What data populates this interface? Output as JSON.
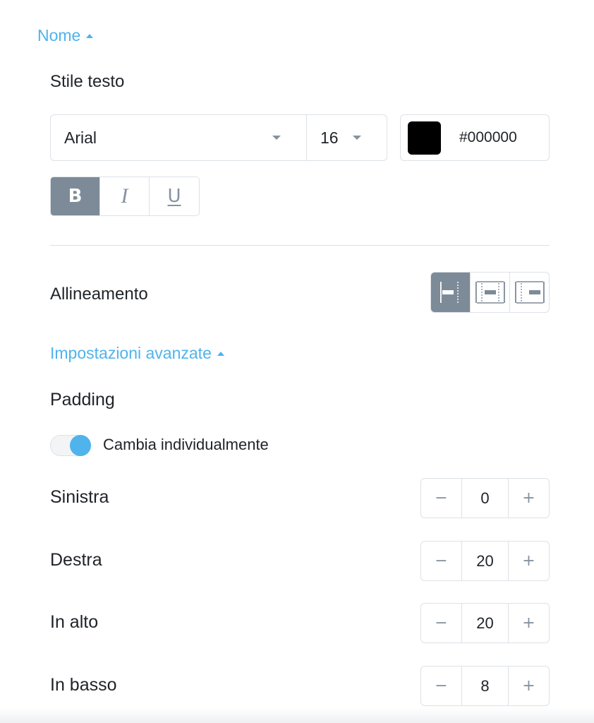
{
  "sections": {
    "name_link": "Nome",
    "advanced_link": "Impostazioni avanzate"
  },
  "text_style": {
    "heading": "Stile testo",
    "font_family": "Arial",
    "font_size": "16",
    "color_hex": "#000000",
    "color_swatch": "#000000",
    "bold_label": "B",
    "italic_label": "I",
    "underline_label": "U",
    "active_style": "bold"
  },
  "alignment": {
    "label": "Allineamento",
    "options": [
      "left-align-icon",
      "center-align-icon",
      "right-align-icon"
    ],
    "selected": "left"
  },
  "padding": {
    "heading": "Padding",
    "toggle_label": "Cambia individualmente",
    "toggle_on": true,
    "rows": [
      {
        "label": "Sinistra",
        "value": "0"
      },
      {
        "label": "Destra",
        "value": "20"
      },
      {
        "label": "In alto",
        "value": "20"
      },
      {
        "label": "In basso",
        "value": "8"
      }
    ],
    "minus": "−",
    "plus": "+"
  },
  "colors": {
    "accent": "#4fb3ec",
    "active_button": "#7d8a98",
    "border": "#dde1e6"
  }
}
